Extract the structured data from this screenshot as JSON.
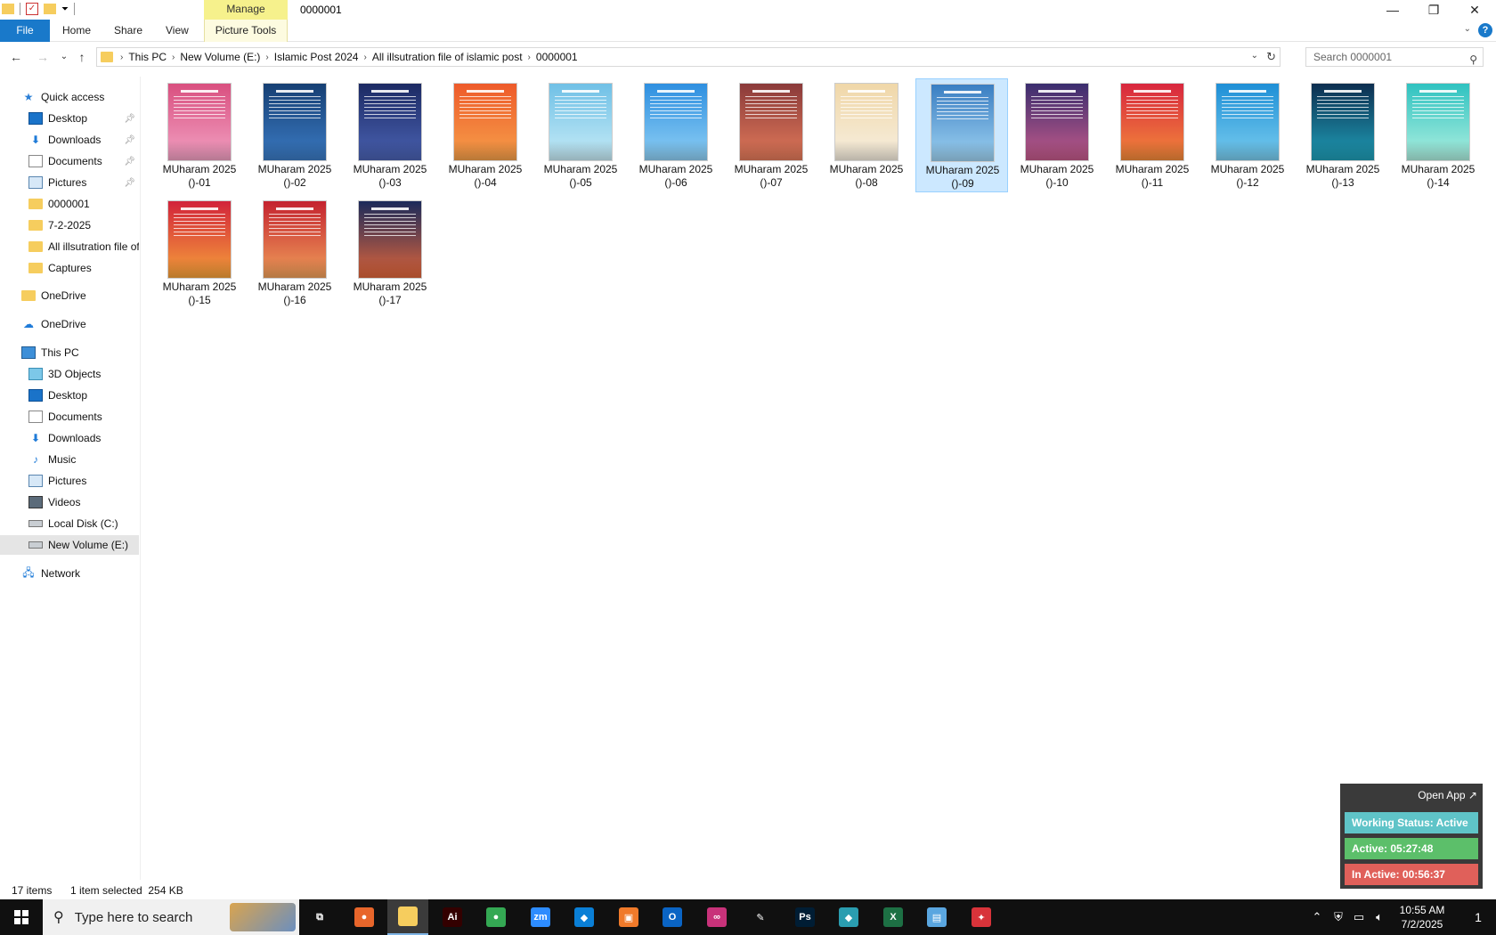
{
  "window": {
    "title": "0000001",
    "manage_tab": "Manage",
    "minimize": "—",
    "restore": "❐",
    "close": "✕"
  },
  "ribbon": {
    "tabs": [
      "File",
      "Home",
      "Share",
      "View",
      "Picture Tools"
    ],
    "help": "?",
    "collapse": "⌄"
  },
  "nav": {
    "back": "←",
    "forward": "→",
    "recent": "⌄",
    "up": "↑",
    "breadcrumbs": [
      "This PC",
      "New Volume (E:)",
      "Islamic Post 2024",
      "All illsutration file of islamic post",
      "0000001"
    ],
    "search_placeholder": "Search 0000001"
  },
  "sidebar": {
    "items": [
      {
        "label": "Quick access",
        "icon": "star-icon",
        "pinned": false
      },
      {
        "label": "Desktop",
        "icon": "desktop-icon",
        "pinned": true
      },
      {
        "label": "Downloads",
        "icon": "download-icon",
        "pinned": true
      },
      {
        "label": "Documents",
        "icon": "documents-icon",
        "pinned": true
      },
      {
        "label": "Pictures",
        "icon": "pictures-icon",
        "pinned": true
      },
      {
        "label": "0000001",
        "icon": "folder-icon",
        "pinned": false
      },
      {
        "label": "7-2-2025",
        "icon": "folder-icon",
        "pinned": false
      },
      {
        "label": "All illsutration file of islamic post",
        "icon": "folder-icon",
        "pinned": false
      },
      {
        "label": "Captures",
        "icon": "folder-icon",
        "pinned": false
      },
      {
        "label": "OneDrive",
        "icon": "folder-icon",
        "pinned": false
      },
      {
        "label": "OneDrive",
        "icon": "cloud-icon",
        "pinned": false
      },
      {
        "label": "This PC",
        "icon": "computer-icon",
        "pinned": false
      },
      {
        "label": "3D Objects",
        "icon": "3d-objects-icon",
        "pinned": false
      },
      {
        "label": "Desktop",
        "icon": "desktop-icon",
        "pinned": false
      },
      {
        "label": "Documents",
        "icon": "documents-icon",
        "pinned": false
      },
      {
        "label": "Downloads",
        "icon": "download-icon",
        "pinned": false
      },
      {
        "label": "Music",
        "icon": "music-icon",
        "pinned": false
      },
      {
        "label": "Pictures",
        "icon": "pictures-icon",
        "pinned": false
      },
      {
        "label": "Videos",
        "icon": "videos-icon",
        "pinned": false
      },
      {
        "label": "Local Disk (C:)",
        "icon": "disk-icon",
        "pinned": false
      },
      {
        "label": "New Volume (E:)",
        "icon": "disk-icon",
        "pinned": false,
        "selected": true
      },
      {
        "label": "Network",
        "icon": "network-icon",
        "pinned": false
      }
    ]
  },
  "files": [
    {
      "line1": "MUharam 2025",
      "line2": "()-01",
      "colors": [
        "#d94f7f",
        "#f2a1c3"
      ]
    },
    {
      "line1": "MUharam 2025",
      "line2": "()-02",
      "colors": [
        "#163f73",
        "#3b7bc4"
      ]
    },
    {
      "line1": "MUharam 2025",
      "line2": "()-03",
      "colors": [
        "#1c2a63",
        "#4a62b3"
      ]
    },
    {
      "line1": "MUharam 2025",
      "line2": "()-04",
      "colors": [
        "#ee5a2a",
        "#f6a04a"
      ]
    },
    {
      "line1": "MUharam 2025",
      "line2": "()-05",
      "colors": [
        "#6fc0e6",
        "#c7ecf7"
      ]
    },
    {
      "line1": "MUharam 2025",
      "line2": "()-06",
      "colors": [
        "#2e8fe0",
        "#8fd0f5"
      ]
    },
    {
      "line1": "MUharam 2025",
      "line2": "()-07",
      "colors": [
        "#8a3a3a",
        "#e27a5a"
      ]
    },
    {
      "line1": "MUharam 2025",
      "line2": "()-08",
      "colors": [
        "#f0d7a8",
        "#f7efe0"
      ]
    },
    {
      "line1": "MUharam 2025",
      "line2": "()-09",
      "colors": [
        "#3a7ec2",
        "#9fd3f2"
      ],
      "selected": true
    },
    {
      "line1": "MUharam 2025",
      "line2": "()-10",
      "colors": [
        "#3a2d6e",
        "#c45a8a"
      ]
    },
    {
      "line1": "MUharam 2025",
      "line2": "()-11",
      "colors": [
        "#d8263e",
        "#f38a3a"
      ]
    },
    {
      "line1": "MUharam 2025",
      "line2": "()-12",
      "colors": [
        "#1e8fd6",
        "#79cdef"
      ]
    },
    {
      "line1": "MUharam 2025",
      "line2": "()-13",
      "colors": [
        "#0d2e4f",
        "#1f9fb8"
      ]
    },
    {
      "line1": "MUharam 2025",
      "line2": "()-14",
      "colors": [
        "#2fc2c0",
        "#aef0e0"
      ]
    },
    {
      "line1": "MUharam 2025",
      "line2": "()-15",
      "colors": [
        "#d2233a",
        "#f6a23a"
      ]
    },
    {
      "line1": "MUharam 2025",
      "line2": "()-16",
      "colors": [
        "#c4222f",
        "#f0a05a"
      ]
    },
    {
      "line1": "MUharam 2025",
      "line2": "()-17",
      "colors": [
        "#1b2a5a",
        "#e0653a"
      ]
    }
  ],
  "status": {
    "count": "17 items",
    "selection": "1 item selected  254 KB"
  },
  "tracker": {
    "open_app": "Open App ↗",
    "working_status": "Working Status: Active",
    "active": "Active: 05:27:48",
    "inactive": "In Active: 00:56:37",
    "colors": {
      "working": "#5fc4c8",
      "active": "#5cbf6a",
      "inactive": "#e0605a"
    }
  },
  "taskbar": {
    "search_placeholder": "Type here to search",
    "apps": [
      {
        "name": "task-view",
        "glyph": "⧉",
        "bg": "transparent"
      },
      {
        "name": "firefox",
        "glyph": "●",
        "bg": "#e8662b"
      },
      {
        "name": "file-explorer",
        "glyph": "",
        "bg": "#f6cd5e",
        "active": true
      },
      {
        "name": "illustrator",
        "glyph": "Ai",
        "bg": "#330000"
      },
      {
        "name": "chrome",
        "glyph": "●",
        "bg": "#34a853"
      },
      {
        "name": "zoom",
        "glyph": "zm",
        "bg": "#2d8cff"
      },
      {
        "name": "vscode",
        "glyph": "◆",
        "bg": "#0a7fd6"
      },
      {
        "name": "app-orange",
        "glyph": "▣",
        "bg": "#f07a2a"
      },
      {
        "name": "outlook",
        "glyph": "O",
        "bg": "#0a64c4"
      },
      {
        "name": "creative-cloud",
        "glyph": "∞",
        "bg": "#c8327a"
      },
      {
        "name": "pen-tool",
        "glyph": "✎",
        "bg": "transparent"
      },
      {
        "name": "photoshop",
        "glyph": "Ps",
        "bg": "#001d34"
      },
      {
        "name": "app-teal",
        "glyph": "◆",
        "bg": "#2a9db0"
      },
      {
        "name": "excel",
        "glyph": "X",
        "bg": "#1d7044"
      },
      {
        "name": "notepad",
        "glyph": "▤",
        "bg": "#5aa6e0"
      },
      {
        "name": "app-red",
        "glyph": "✦",
        "bg": "#d8333a"
      }
    ],
    "tray": {
      "chevron": "⌃",
      "time": "10:55 AM",
      "date": "7/2/2025",
      "notifications": "1"
    }
  }
}
